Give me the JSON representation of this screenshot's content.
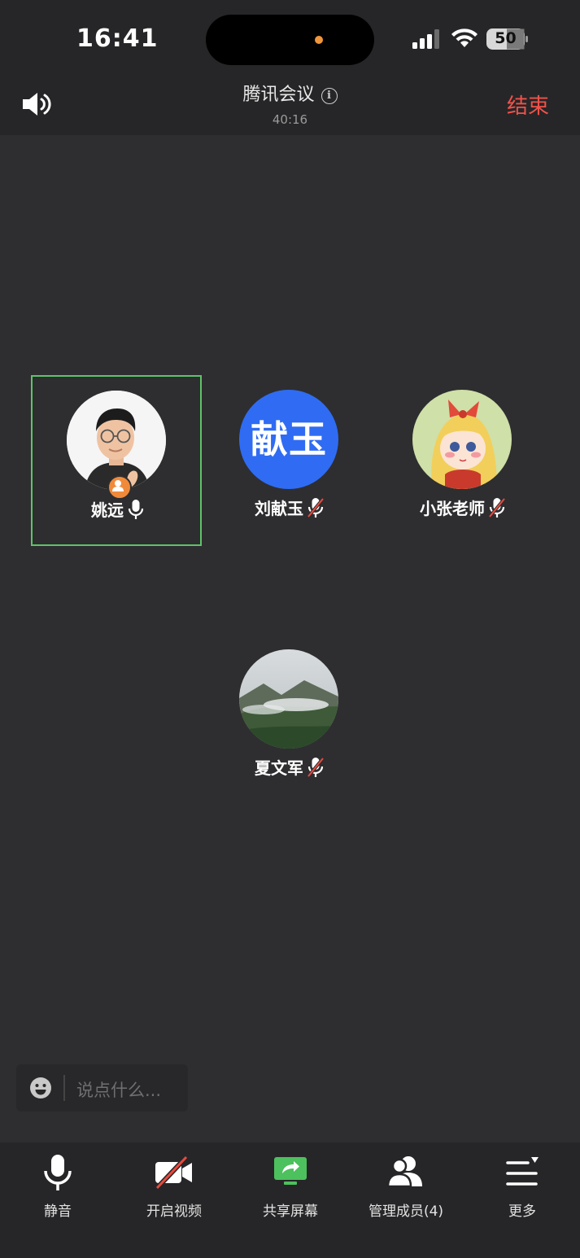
{
  "status_bar": {
    "time": "16:41",
    "battery": "50"
  },
  "header": {
    "title": "腾讯会议",
    "duration": "40:16",
    "end_label": "结束"
  },
  "participants": [
    {
      "name": "姚远",
      "mic": "on",
      "avatar": "photo",
      "host": true,
      "active": true
    },
    {
      "name": "刘献玉",
      "mic": "muted",
      "avatar_text": "献玉",
      "avatar_color": "#2f6cf3"
    },
    {
      "name": "小张老师",
      "mic": "muted",
      "avatar": "cartoon-girl"
    },
    {
      "name": "夏文军",
      "mic": "muted",
      "avatar": "misty-mountain"
    }
  ],
  "chat": {
    "placeholder": "说点什么..."
  },
  "toolbar": {
    "mute_label": "静音",
    "video_label": "开启视频",
    "share_label": "共享屏幕",
    "members_label": "管理成员(4)",
    "more_label": "更多"
  },
  "colors": {
    "background": "#2e2e30",
    "bar": "#262628",
    "active_border": "#5fc36a",
    "end": "#f1524a",
    "share_green": "#4cc15d",
    "video_slash": "#e84a3f"
  }
}
